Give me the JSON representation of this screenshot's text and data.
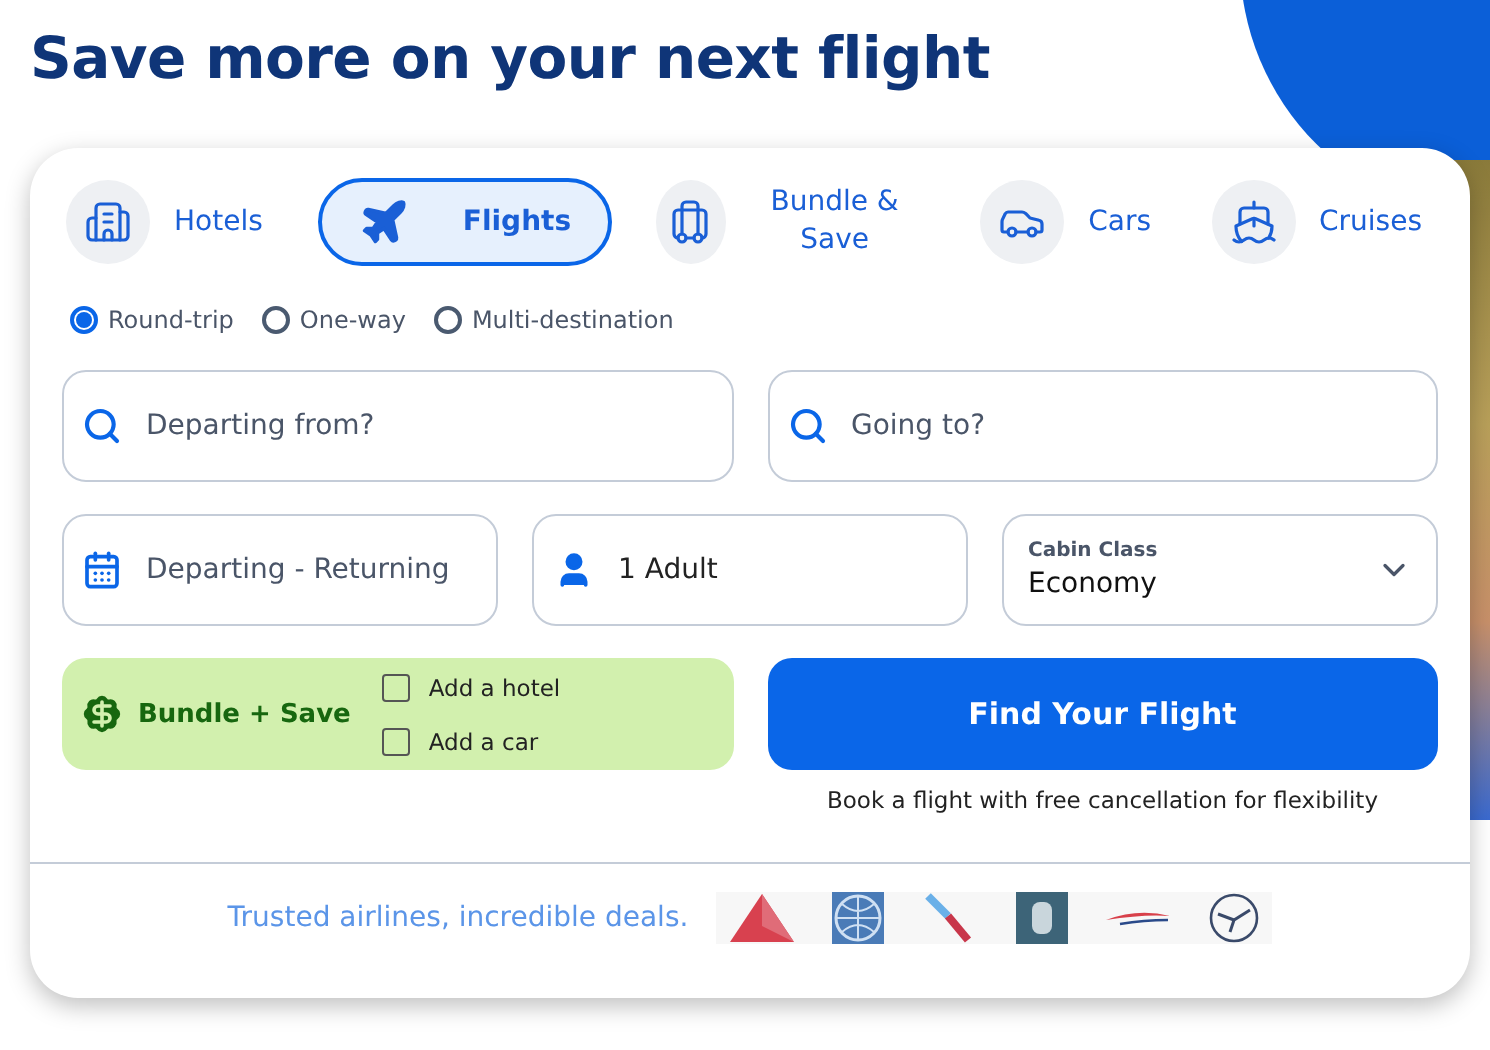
{
  "title": "Save more on your next flight",
  "tabs": [
    {
      "label": "Hotels",
      "selected": false
    },
    {
      "label": "Flights",
      "selected": true
    },
    {
      "label": "Bundle & Save",
      "selected": false
    },
    {
      "label": "Cars",
      "selected": false
    },
    {
      "label": "Cruises",
      "selected": false
    }
  ],
  "trip_types": [
    {
      "label": "Round-trip",
      "selected": true
    },
    {
      "label": "One-way",
      "selected": false
    },
    {
      "label": "Multi-destination",
      "selected": false
    }
  ],
  "origin": {
    "placeholder": "Departing from?"
  },
  "destination": {
    "placeholder": "Going to?"
  },
  "dates": {
    "placeholder": "Departing - Returning"
  },
  "travelers": {
    "value": "1 Adult"
  },
  "cabin_class": {
    "label": "Cabin Class",
    "value": "Economy"
  },
  "bundle": {
    "title": "Bundle + Save",
    "options": [
      {
        "label": "Add a hotel",
        "checked": false
      },
      {
        "label": "Add a car",
        "checked": false
      }
    ]
  },
  "search_button": "Find Your Flight",
  "caption": "Book a flight with free cancellation for flexibility",
  "footer": {
    "text": "Trusted airlines, incredible deals."
  }
}
